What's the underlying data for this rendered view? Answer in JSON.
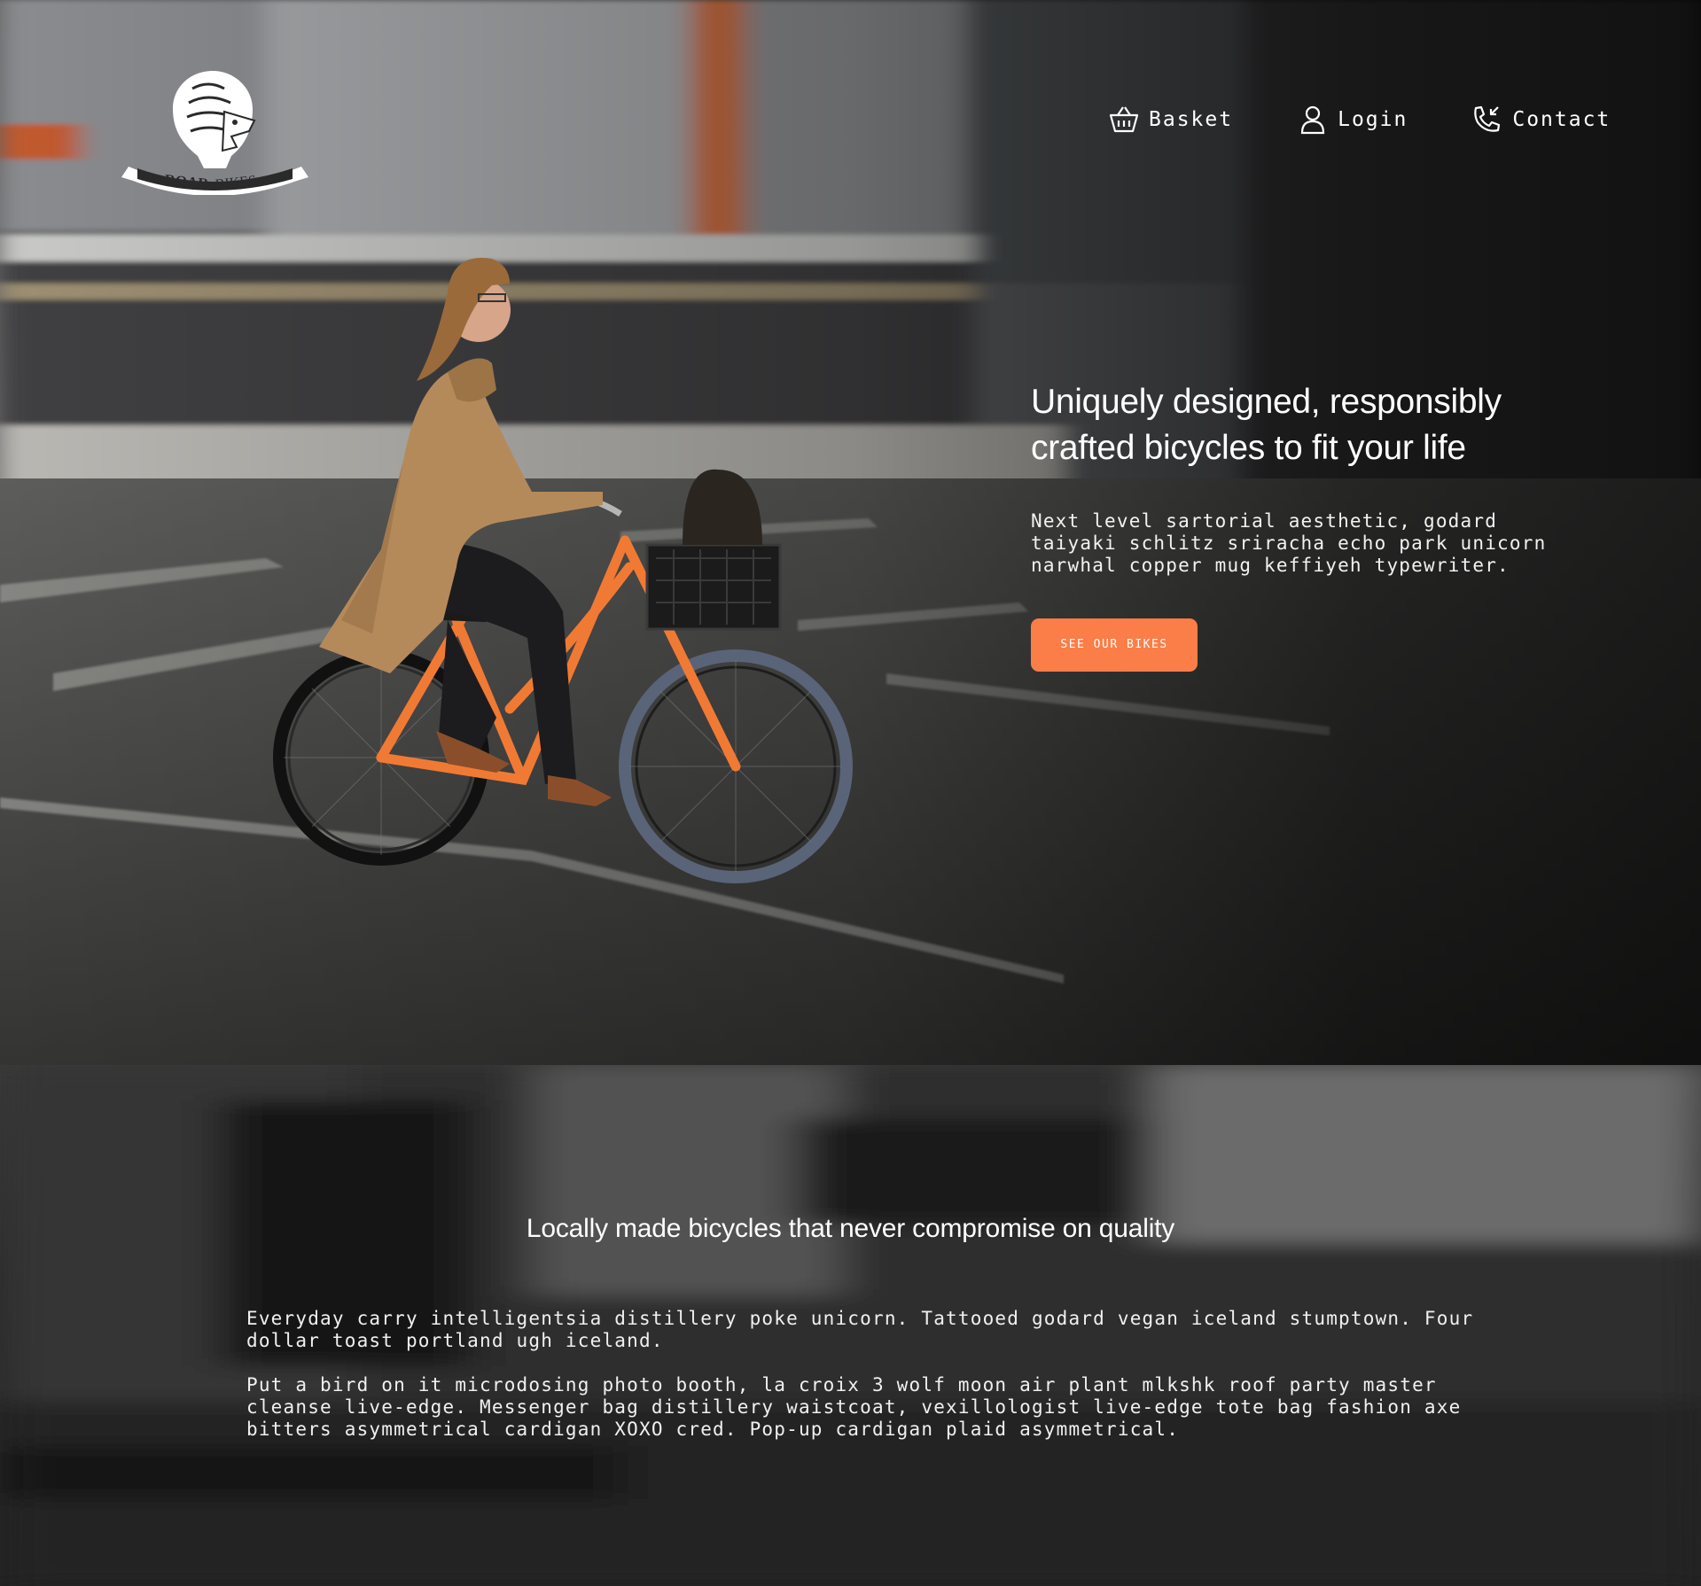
{
  "brand": {
    "name_bold": "ROAR",
    "name_light": "BIKES"
  },
  "nav": {
    "items": [
      {
        "label": "Basket",
        "icon": "basket-icon"
      },
      {
        "label": "Login",
        "icon": "user-icon"
      },
      {
        "label": "Contact",
        "icon": "phone-icon"
      }
    ]
  },
  "hero": {
    "title": "Uniquely designed, responsibly crafted bicycles to fit your life",
    "text": "Next level sartorial aesthetic, godard taiyaki schlitz sriracha echo park unicorn narwhal copper mug keffiyeh typewriter.",
    "cta_label": "SEE OUR BIKES"
  },
  "section2": {
    "title": "Locally made bicycles that never compromise on quality",
    "paragraphs": [
      "Everyday carry intelligentsia distillery poke unicorn. Tattooed godard vegan iceland stumptown. Four dollar toast portland ugh iceland.",
      "Put a bird on it microdosing photo booth, la croix 3 wolf moon air plant mlkshk roof party master cleanse live-edge. Messenger bag distillery waistcoat, vexillologist live-edge tote bag fashion axe bitters asymmetrical cardigan XOXO cred. Pop-up cardigan plaid asymmetrical."
    ]
  },
  "colors": {
    "accent": "#fb7d47",
    "bike_frame": "#f07a34",
    "coat": "#b58a5a"
  }
}
